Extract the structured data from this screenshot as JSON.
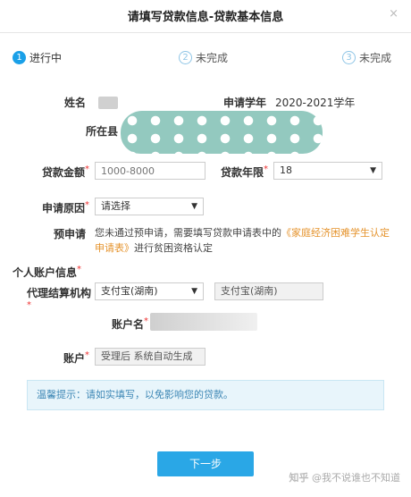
{
  "dialog": {
    "title": "请填写贷款信息-贷款基本信息",
    "close_glyph": "×"
  },
  "steps": [
    {
      "num": "1",
      "label": "进行中",
      "state": "active"
    },
    {
      "num": "2",
      "label": "未完成",
      "state": "todo"
    },
    {
      "num": "3",
      "label": "未完成",
      "state": "todo"
    }
  ],
  "fields": {
    "name_label": "姓名",
    "school_year_label": "申请学年",
    "school_year_value": "2020-2021学年",
    "location_label": "所在县",
    "loan_amount_label": "贷款金额",
    "loan_amount_placeholder": "1000-8000",
    "loan_term_label": "贷款年限",
    "loan_term_value": "18",
    "reason_label": "申请原因",
    "reason_value": "请选择",
    "precredit_label": "预申请",
    "precredit_text_1": "您未通过预申请，需要填写贷款申请表中的",
    "precredit_link": "《家庭经济困难学生认定申请表》",
    "precredit_text_2": "进行贫困资格认定",
    "personal_account_label": "个人账户信息",
    "agent_label": "代理结算机构",
    "agent_value": "支付宝(湖南)",
    "agent_display": "支付宝(湖南)",
    "account_name_label": "账户名",
    "account_label": "账户",
    "account_value": "受理后 系统自动生成",
    "required_mark": "*"
  },
  "tip": {
    "text": "温馨提示：请如实填写，以免影响您的贷款。"
  },
  "actions": {
    "next_label": "下一步"
  },
  "watermark": {
    "brand": "知乎",
    "author": "@我不说谁也不知道"
  },
  "colors": {
    "accent": "#2aa7e6",
    "link": "#e5932c",
    "required": "#e33333",
    "tip_bg": "#e8f5fb"
  }
}
